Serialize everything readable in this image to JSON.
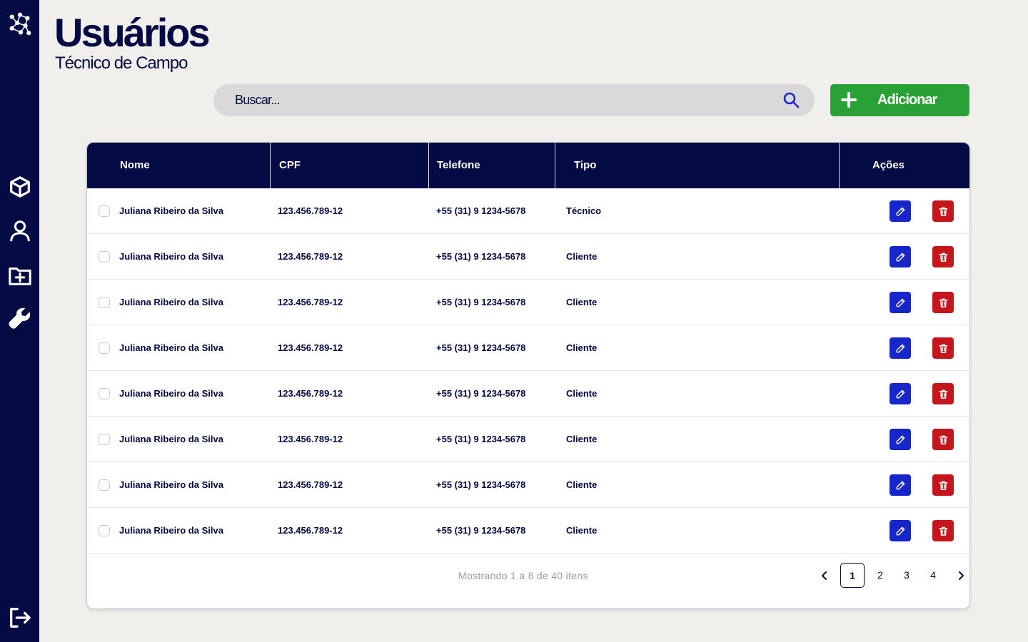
{
  "page": {
    "title": "Usuários",
    "subtitle": "Técnico de Campo"
  },
  "sidebar": {
    "items": [
      {
        "icon": "network-logo-icon"
      },
      {
        "icon": "cube-icon"
      },
      {
        "icon": "user-icon"
      },
      {
        "icon": "folder-plus-icon"
      },
      {
        "icon": "wrench-icon"
      },
      {
        "icon": "logout-icon"
      }
    ]
  },
  "search": {
    "placeholder": "Buscar...",
    "value": ""
  },
  "toolbar": {
    "add_label": "Adicionar"
  },
  "colors": {
    "navy": "#040a44",
    "green": "#2aa137",
    "edit_blue": "#1726c9",
    "delete_red": "#c4161c",
    "background": "#f0efec"
  },
  "table": {
    "headers": {
      "nome": "Nome",
      "cpf": "CPF",
      "telefone": "Telefone",
      "tipo": "Tipo",
      "acoes": "Ações"
    },
    "rows": [
      {
        "nome": "Juliana Ribeiro da Silva",
        "cpf": "123.456.789-12",
        "telefone": "+55 (31) 9 1234-5678",
        "tipo": "Técnico"
      },
      {
        "nome": "Juliana Ribeiro da Silva",
        "cpf": "123.456.789-12",
        "telefone": "+55 (31) 9 1234-5678",
        "tipo": "Cliente"
      },
      {
        "nome": "Juliana Ribeiro da Silva",
        "cpf": "123.456.789-12",
        "telefone": "+55 (31) 9 1234-5678",
        "tipo": "Cliente"
      },
      {
        "nome": "Juliana Ribeiro da Silva",
        "cpf": "123.456.789-12",
        "telefone": "+55 (31) 9 1234-5678",
        "tipo": "Cliente"
      },
      {
        "nome": "Juliana Ribeiro da Silva",
        "cpf": "123.456.789-12",
        "telefone": "+55 (31) 9 1234-5678",
        "tipo": "Cliente"
      },
      {
        "nome": "Juliana Ribeiro da Silva",
        "cpf": "123.456.789-12",
        "telefone": "+55 (31) 9 1234-5678",
        "tipo": "Cliente"
      },
      {
        "nome": "Juliana Ribeiro da Silva",
        "cpf": "123.456.789-12",
        "telefone": "+55 (31) 9 1234-5678",
        "tipo": "Cliente"
      },
      {
        "nome": "Juliana Ribeiro da Silva",
        "cpf": "123.456.789-12",
        "telefone": "+55 (31) 9 1234-5678",
        "tipo": "Cliente"
      }
    ]
  },
  "pagination": {
    "info": "Mostrando 1 a 8 de 40 itens",
    "pages": [
      "1",
      "2",
      "3",
      "4"
    ],
    "current": "1"
  }
}
